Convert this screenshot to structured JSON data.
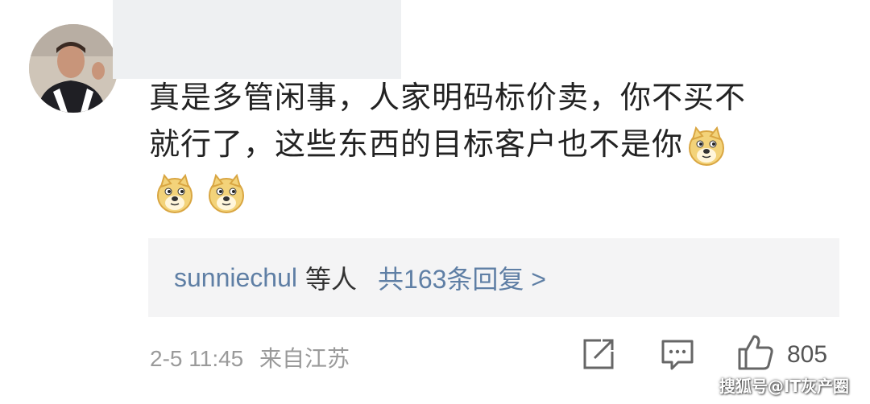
{
  "comment": {
    "line1": "真是多管闲事，人家明码标价卖，你不买不",
    "line2": "就行了，这些东西的目标客户也不是你",
    "emoji_name": "doge-emoji"
  },
  "replies": {
    "users": "sunniechul",
    "users_suffix": "等人",
    "count_text": "共163条回复 >"
  },
  "meta": {
    "time": "2-5 11:45",
    "location": "来自江苏"
  },
  "actions": {
    "share_icon": "share-icon",
    "comment_icon": "comment-icon",
    "like_icon": "thumbs-up-icon",
    "like_count": "805"
  },
  "watermark": "搜狐号@IT灰产圈",
  "colors": {
    "link": "#5f7fa5",
    "reply_bg": "#f4f4f5",
    "meta": "#9a9a9a"
  }
}
